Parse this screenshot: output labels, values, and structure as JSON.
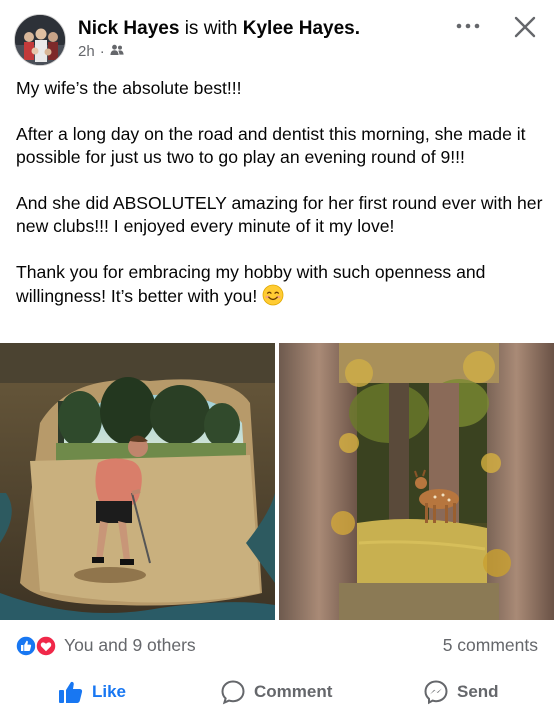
{
  "post": {
    "author": "Nick Hayes",
    "with_text": "is with",
    "tagged": "Kylee Hayes.",
    "time": "2h",
    "separator": "·",
    "audience_icon": "friends-icon",
    "paragraphs": [
      "My wife’s the absolute best!!!",
      "After a long day on the road and dentist this morning, she made it possible for just us two to go play an evening round of 9!!!",
      "And she did ABSOLUTELY amazing for her first round ever with her new clubs!!! I enjoyed every minute of it my love!",
      "Thank you for embracing my hobby with such openness and willingness!  It’s better with you!"
    ],
    "emoji": "smiling-face-emoji"
  },
  "reactions": {
    "text": "You and 9 others",
    "comments": "5 comments",
    "icons": [
      "like-reaction-icon",
      "love-reaction-icon"
    ]
  },
  "actions": {
    "like": "Like",
    "comment": "Comment",
    "send": "Send"
  },
  "colors": {
    "brand_blue": "#1877f2",
    "love_red": "#f02849",
    "secondary_text": "#65676b"
  }
}
